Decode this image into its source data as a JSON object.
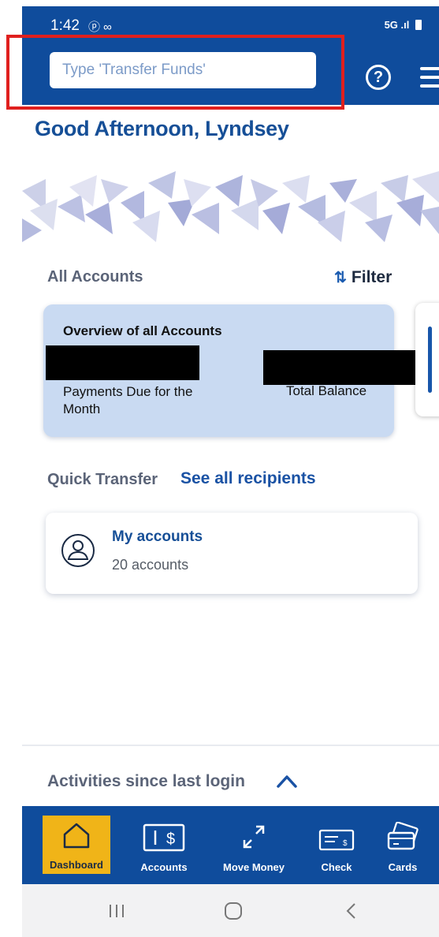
{
  "status_bar": {
    "time": "1:42",
    "left_icons": "ⓟ ∞",
    "right_text": "5G"
  },
  "search": {
    "placeholder": "Type 'Transfer Funds'"
  },
  "greeting": "Good Afternoon, Lyndsey",
  "accounts": {
    "section_label": "All Accounts",
    "filter_label": "Filter",
    "overview": {
      "title": "Overview of all Accounts",
      "payments_label": "Payments Due for the Month",
      "balance_label": "Total Balance"
    }
  },
  "quick_transfer": {
    "label": "Quick Transfer",
    "link": "See all recipients",
    "recipient": {
      "name": "My accounts",
      "count": "20 accounts"
    }
  },
  "activities": {
    "label": "Activities since last login"
  },
  "bottom_nav": {
    "items": [
      {
        "label": "Dashboard",
        "icon": "home-icon",
        "active": true
      },
      {
        "label": "Accounts",
        "icon": "accounts-icon"
      },
      {
        "label": "Move Money",
        "icon": "move-money-icon"
      },
      {
        "label": "Check",
        "icon": "check-icon"
      },
      {
        "label": "Cards",
        "icon": "cards-icon"
      }
    ]
  },
  "colors": {
    "brand_blue": "#0f4c9c",
    "active_tab": "#f0b418",
    "card_bg": "#c9daf2",
    "highlight": "#e0201e"
  }
}
